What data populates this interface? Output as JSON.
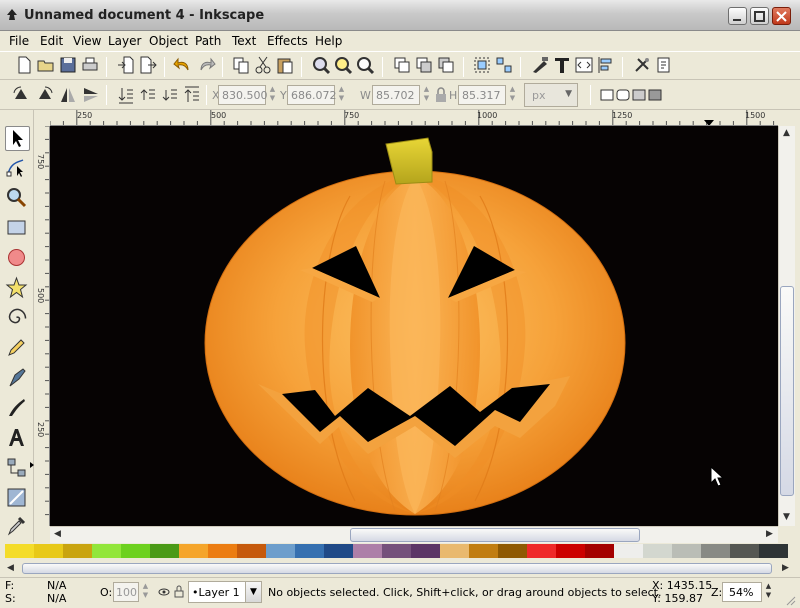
{
  "window": {
    "title": "Unnamed document 4 - Inkscape",
    "buttons": [
      "minimize",
      "maximize",
      "close"
    ]
  },
  "menu": {
    "items": [
      "File",
      "Edit",
      "View",
      "Layer",
      "Object",
      "Path",
      "Text",
      "Effects",
      "Help"
    ]
  },
  "toolbar_commands": {
    "icons": [
      "new-icon",
      "open-icon",
      "save-icon",
      "print-icon",
      "import-icon",
      "export-icon",
      "undo-icon",
      "redo-icon",
      "copy-icon",
      "cut-icon",
      "paste-icon",
      "zoom-selection-icon",
      "zoom-drawing-icon",
      "zoom-page-icon",
      "duplicate-icon",
      "clone-icon",
      "unlink-clone-icon",
      "group-icon",
      "ungroup-icon",
      "fill-stroke-icon",
      "text-font-icon",
      "xml-editor-icon",
      "align-icon",
      "preferences-icon",
      "document-properties-icon"
    ]
  },
  "toolbar_select": {
    "x_label": "X",
    "x_value": "830.500",
    "y_label": "Y",
    "y_value": "686.072",
    "w_label": "W",
    "w_value": "85.702",
    "h_label": "H",
    "h_value": "85.317",
    "unit": "px"
  },
  "ruler": {
    "top_labels": [
      "250",
      "500",
      "750",
      "1000",
      "1250",
      "1500"
    ],
    "left_labels": [
      "750",
      "500",
      "250"
    ]
  },
  "status": {
    "fill_label": "F:",
    "fill_value": "N/A",
    "stroke_label": "S:",
    "stroke_value": "N/A",
    "opacity_label": "O:",
    "opacity_value": "100",
    "layer": "•Layer 1",
    "message": "No objects selected. Click, Shift+click, or drag around objects to select.",
    "cursor_x": "X: 1435.15",
    "cursor_y": "Y: 159.87",
    "zoom_label": "Z:",
    "zoom_value": "54%"
  },
  "palette": {
    "colors": [
      "#f4dc29",
      "#e8c918",
      "#c9a40f",
      "#92e63a",
      "#6dd11f",
      "#4a9a16",
      "#f5a52a",
      "#ec7d11",
      "#c65a0c",
      "#6d9ecc",
      "#3670b0",
      "#204a87",
      "#ad7fa8",
      "#75507b",
      "#5c3566",
      "#e9b96e",
      "#c17d11",
      "#8f5902",
      "#ef2929",
      "#cc0000",
      "#a40000",
      "#eeeeec",
      "#d3d7cf",
      "#babdb6",
      "#888a85",
      "#555753",
      "#2e3436"
    ]
  },
  "colors": {
    "canvas_bg": "#060303",
    "pumpkin_light": "#f9b24a",
    "pumpkin_dark": "#e27b14",
    "stem": "#d4c22a"
  }
}
